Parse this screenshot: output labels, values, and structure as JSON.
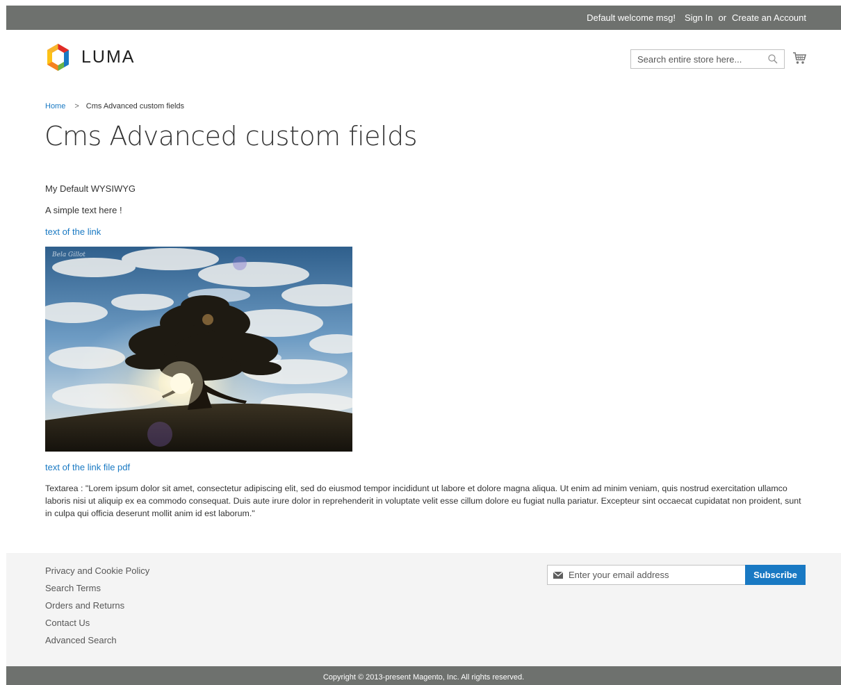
{
  "panel": {
    "welcome": "Default welcome msg!",
    "sign_in": "Sign In",
    "or": "or",
    "create_account": "Create an Account"
  },
  "header": {
    "logo_text": "LUMA",
    "search_placeholder": "Search entire store here...",
    "search_icon": "magnifier-icon",
    "cart_icon": "shopping-cart-icon"
  },
  "breadcrumbs": {
    "home": "Home",
    "separator": ">",
    "current": "Cms Advanced custom fields"
  },
  "page_title": "Cms Advanced custom fields",
  "content": {
    "wysiwyg": "My Default WYSIWYG",
    "simple_text": "A simple text here !",
    "link_text": "text of the link",
    "image_watermark": "Bela Gillot",
    "pdf_link_text": "text of the link file pdf",
    "textarea": "Textarea : \"Lorem ipsum dolor sit amet, consectetur adipiscing elit, sed do eiusmod tempor incididunt ut labore et dolore magna aliqua. Ut enim ad minim veniam, quis nostrud exercitation ullamco laboris nisi ut aliquip ex ea commodo consequat. Duis aute irure dolor in reprehenderit in voluptate velit esse cillum dolore eu fugiat nulla pariatur. Excepteur sint occaecat cupidatat non proident, sunt in culpa qui officia deserunt mollit anim id est laborum.\""
  },
  "footer": {
    "links": [
      "Privacy and Cookie Policy",
      "Search Terms",
      "Orders and Returns",
      "Contact Us",
      "Advanced Search"
    ],
    "newsletter_placeholder": "Enter your email address",
    "newsletter_icon": "envelope-icon",
    "subscribe_label": "Subscribe",
    "copyright": "Copyright © 2013-present Magento, Inc. All rights reserved."
  },
  "colors": {
    "panel_bg": "#6e716e",
    "link": "#1979c3",
    "footer_bg": "#f4f4f4",
    "button": "#1979c3"
  }
}
